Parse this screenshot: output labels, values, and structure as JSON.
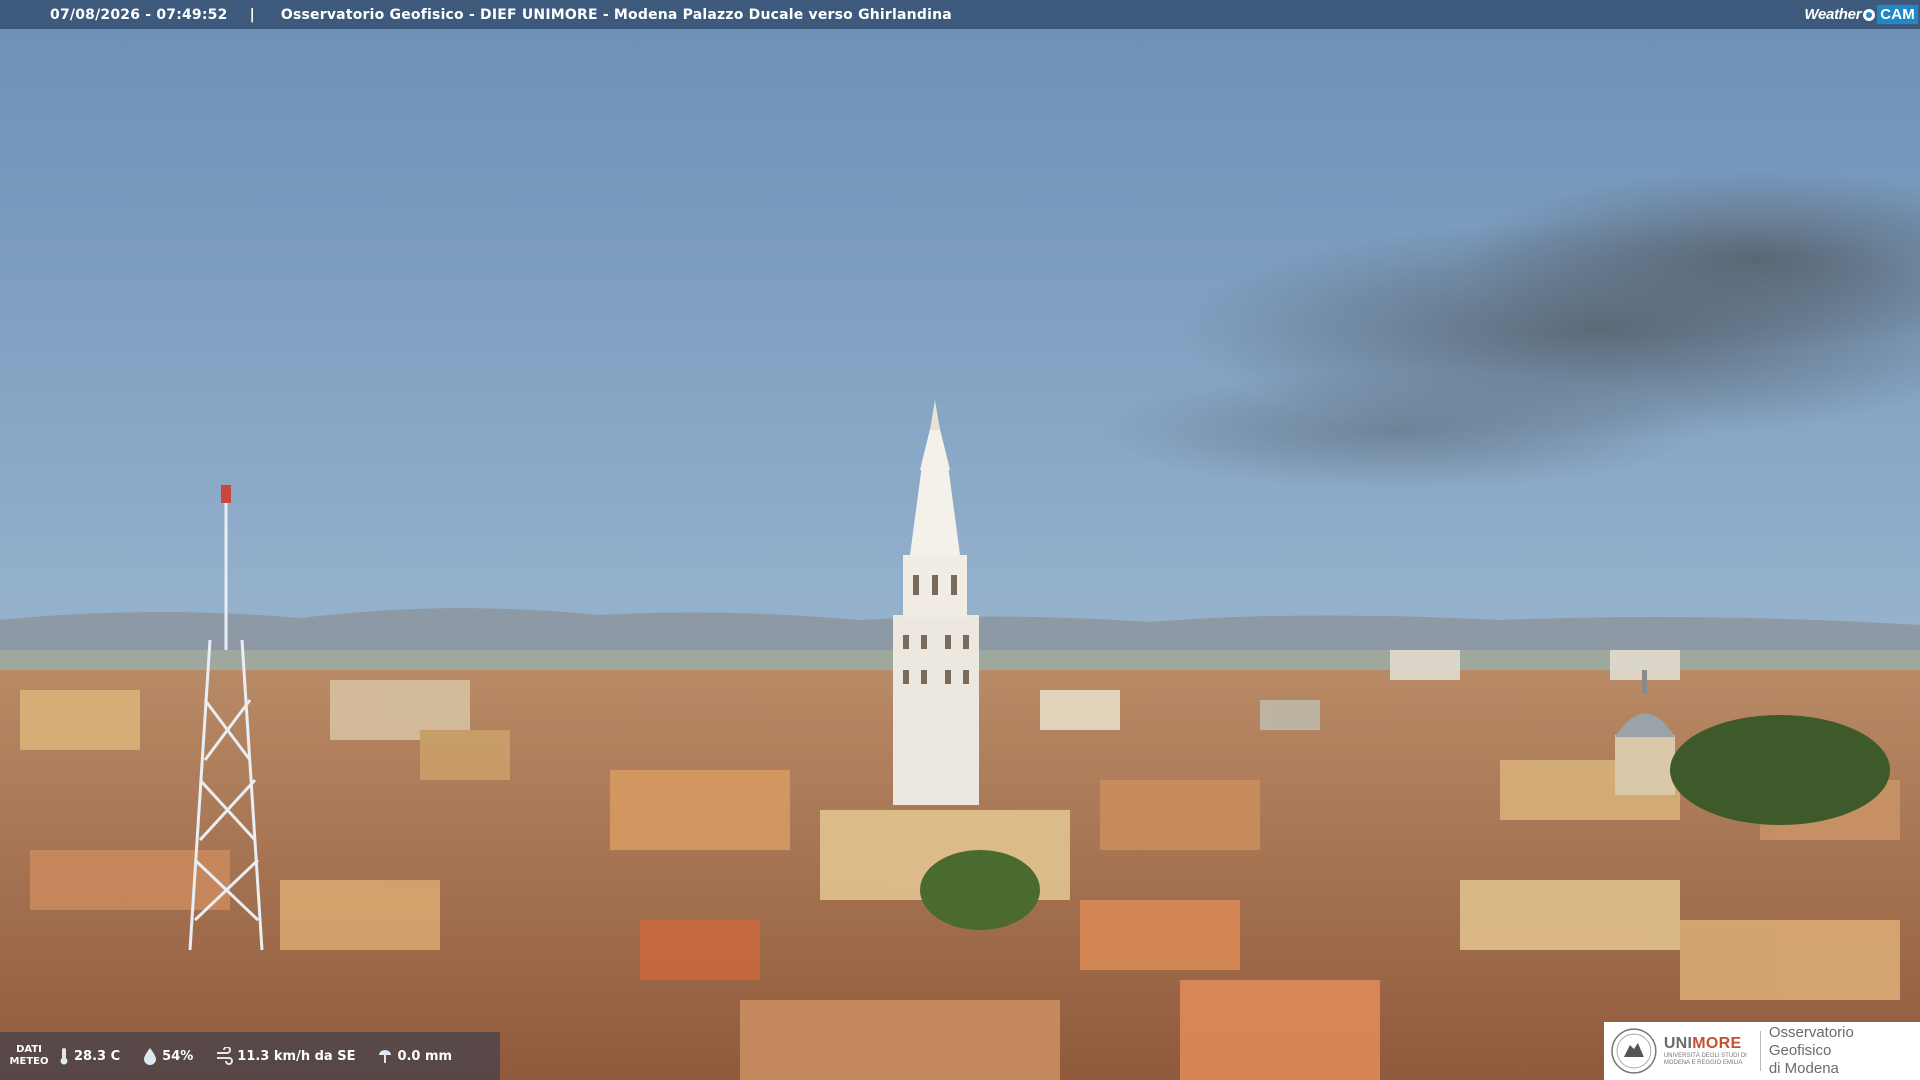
{
  "header": {
    "timestamp": "07/08/2026 - 07:49:52",
    "separator": "|",
    "title": "Osservatorio Geofisico - DIEF UNIMORE - Modena Palazzo Ducale verso Ghirlandina"
  },
  "brand": {
    "weather": "Weather",
    "cam": "CAM",
    "icon": "eye-icon"
  },
  "meteo": {
    "label_line1": "DATI",
    "label_line2": "METEO",
    "temperature": "28.3 C",
    "humidity": "54%",
    "wind": "11.3 km/h da SE",
    "rain": "0.0 mm",
    "icons": [
      "thermometer-icon",
      "humidity-drop-icon",
      "wind-icon",
      "rain-icon"
    ]
  },
  "logo": {
    "uni_prefix": "UNI",
    "uni_suffix": "MORE",
    "uni_subtitle": "UNIVERSITÀ DEGLI STUDI DI MODENA E REGGIO EMILIA",
    "observatory_line1": "Osservatorio Geofisico",
    "observatory_line2": "di Modena",
    "accent_color": "#c6502e"
  },
  "colors": {
    "header_bar": "#3d5a7c",
    "brand_blue": "#1e88c8"
  }
}
